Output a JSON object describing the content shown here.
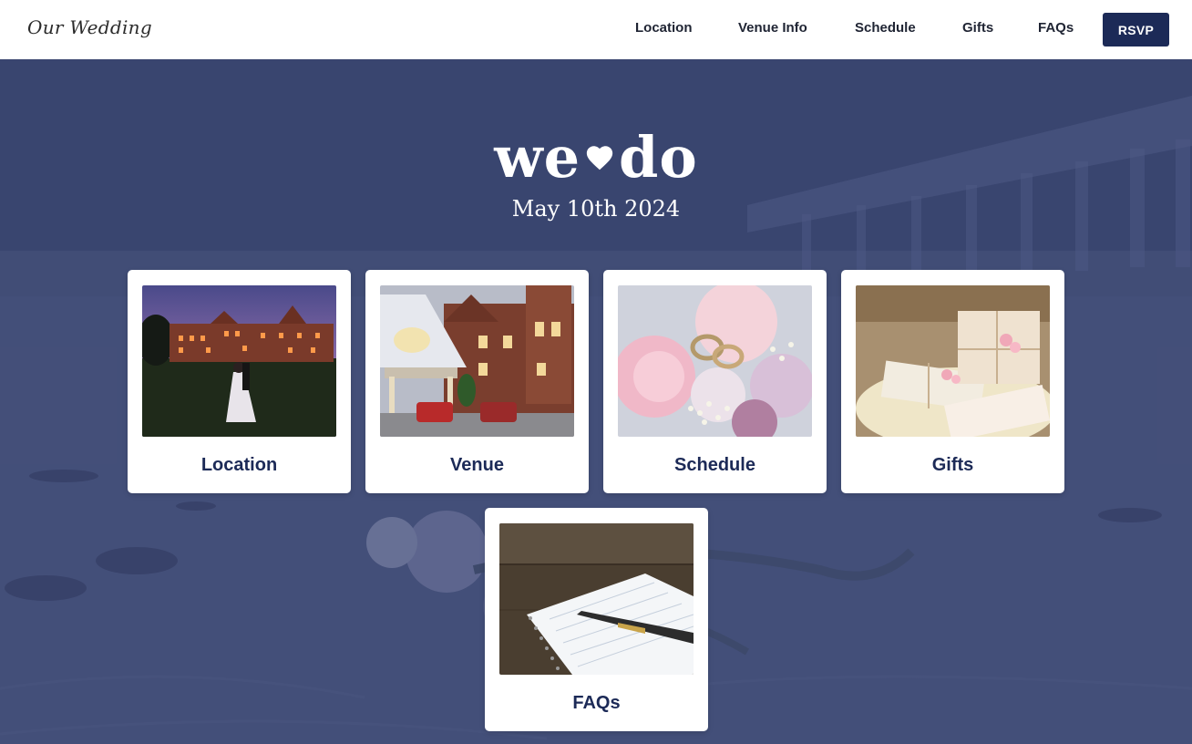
{
  "brand": "Our Wedding",
  "nav": {
    "links": [
      "Location",
      "Venue Info",
      "Schedule",
      "Gifts",
      "FAQs"
    ],
    "rsvp_label": "RSVP"
  },
  "hero": {
    "title_left": "we",
    "title_right": "do",
    "heart_icon": "heart-icon",
    "date": "May 10th 2024"
  },
  "cards": [
    {
      "label": "Location",
      "image": "manor-house-at-night-photo"
    },
    {
      "label": "Venue",
      "image": "venue-building-photo"
    },
    {
      "label": "Schedule",
      "image": "wedding-rings-bouquet-photo"
    },
    {
      "label": "Gifts",
      "image": "wrapped-gifts-photo"
    },
    {
      "label": "FAQs",
      "image": "notebook-and-pen-photo"
    }
  ],
  "colors": {
    "accent": "#1c2a57",
    "hero_overlay": "#46527a",
    "nav_text": "#1f2433"
  }
}
